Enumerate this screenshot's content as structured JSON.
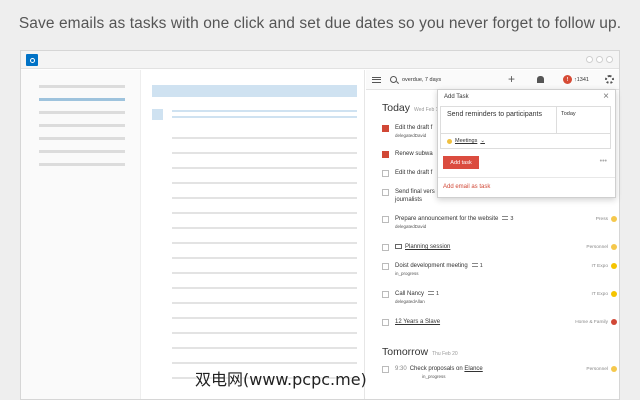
{
  "banner": {
    "text": "Save emails as tasks with one click and set due dates so you never forget to follow up."
  },
  "toolbar": {
    "query": "overdue, 7 days",
    "karma_count": "↑1341"
  },
  "sections": {
    "today": {
      "heading": "Today",
      "date": "Wed Feb 19"
    },
    "tomorrow": {
      "heading": "Tomorrow",
      "date": "Thu Feb 20"
    }
  },
  "tasks": [
    {
      "text": "Edit the draft f",
      "sub": "delegatedDavid",
      "priority": true
    },
    {
      "text": "Renew subwa",
      "sub": "",
      "priority": true
    },
    {
      "text": "Edit the draft f",
      "sub": "",
      "priority": false
    },
    {
      "text": "Send final vers",
      "text2": "journalists",
      "sub": "",
      "priority": false
    },
    {
      "text": "Prepare announcement for the website",
      "comments": "3",
      "sub": "delegatedDavid",
      "project": "Press",
      "project_color": "#f5c84c"
    },
    {
      "text": "Planning session",
      "sub": "",
      "project": "Personnel",
      "project_color": "#f5c84c"
    },
    {
      "text": "Doist development meeting",
      "comments": "1",
      "sub": "in_progress",
      "project": "IT Expo",
      "project_color": "#f5c400"
    },
    {
      "text": "Call Nancy",
      "comments": "1",
      "sub": "delegatedAllan",
      "project": "IT Expo",
      "project_color": "#f5c400"
    },
    {
      "text": "12 Years a Slave",
      "sub": "",
      "project": "Home & Family",
      "project_color": "#d14836"
    },
    {
      "text": "Check proposals on Elance",
      "text_pre": "Check proposals on ",
      "text_link": "Elance",
      "time": "9:30",
      "sub": "in_progress",
      "project": "Personnel",
      "project_color": "#f5c84c"
    }
  ],
  "popup": {
    "title": "Add Task",
    "close": "×",
    "content": "Send reminders to participants",
    "date": "Today",
    "project": "Meetings",
    "project_caret": "⌄",
    "add_button": "Add task",
    "more": "•••",
    "email_link": "Add email as task"
  },
  "watermark": {
    "text": "双电网(www.pcpc.me)"
  },
  "colors": {
    "accent_red": "#d14836",
    "outlook_blue": "#0072c6",
    "placeholder_blue": "#cfe2f1"
  }
}
